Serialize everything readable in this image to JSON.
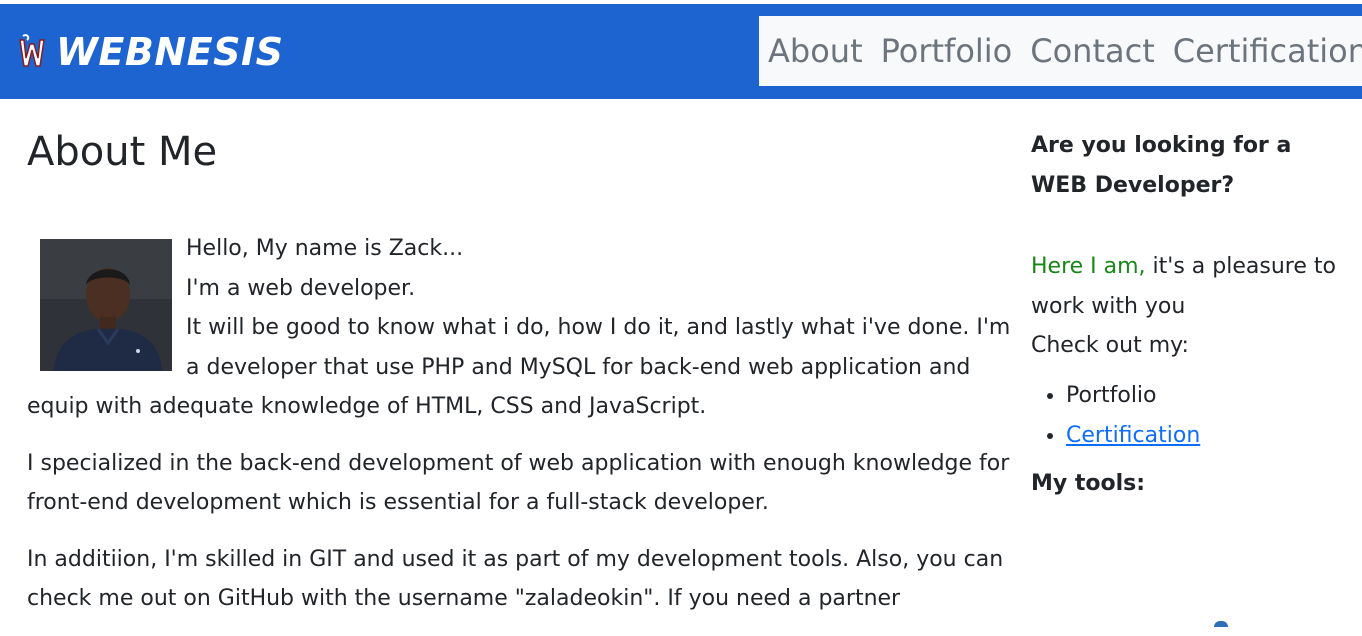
{
  "brand": {
    "name": "WEBNESIS",
    "logo_icon": "webnesis-w-logo-icon"
  },
  "nav": {
    "items": [
      {
        "label": "About"
      },
      {
        "label": "Portfolio"
      },
      {
        "label": "Contact"
      },
      {
        "label": "Certification"
      }
    ]
  },
  "main": {
    "title": "About Me",
    "avatar_icon": "profile-photo",
    "intro": {
      "line1": "Hello, My name is Zack...",
      "line2": "I'm a web developer.",
      "line3": "It will be good to know what i do, how I do it, and lastly what i've done. I'm a developer that use PHP and MySQL for back-end web application and equip with adequate knowledge of HTML, CSS and JavaScript."
    },
    "paragraph2": "I specialized in the back-end development of web application with enough knowledge for front-end development which is essential for a full-stack developer.",
    "paragraph3": "In additiion, I'm skilled in GIT and used it as part of my development tools. Also, you can check me out on GitHub with the username \"zaladeokin\". If you need a partner"
  },
  "sidebar": {
    "heading": "Are you looking for a WEB Developer?",
    "intro_highlight": "Here I am,",
    "intro_rest": " it's a pleasure to work with you",
    "check_out": "Check out my:",
    "links": [
      {
        "label": "Portfolio"
      },
      {
        "label": "Certification"
      }
    ],
    "tools_heading": "My tools:"
  },
  "colors": {
    "navbar": "#1d64d1",
    "nav_panel": "#f8f9fa",
    "nav_link": "#6c757d",
    "highlight_green": "#198717",
    "link_blue": "#0d6efd",
    "text": "#212529"
  }
}
